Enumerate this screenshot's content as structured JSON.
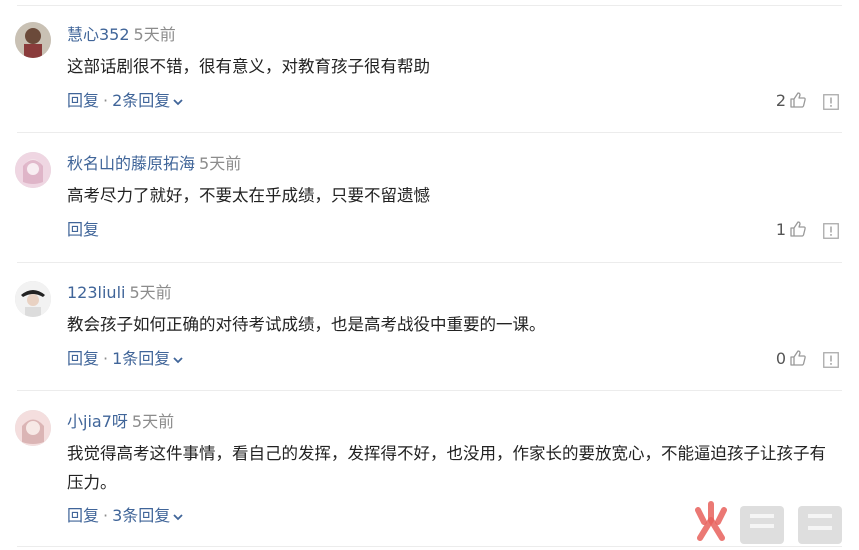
{
  "comments": [
    {
      "username": "慧心352",
      "time": "5天前",
      "text": "这部话剧很不错，很有意义，对教育孩子很有帮助",
      "reply_label": "回复",
      "separator": "·",
      "replies_label": "2条回复",
      "likes": "2"
    },
    {
      "username": "秋名山的藤原拓海",
      "time": "5天前",
      "text": "高考尽力了就好，不要太在乎成绩，只要不留遗憾",
      "reply_label": "回复",
      "likes": "1"
    },
    {
      "username": "123liuli",
      "time": "5天前",
      "text": "教会孩子如何正确的对待考试成绩，也是高考战役中重要的一课。",
      "reply_label": "回复",
      "separator": "·",
      "replies_label": "1条回复",
      "likes": "0"
    },
    {
      "username": "小jia7呀",
      "time": "5天前",
      "text": "我觉得高考这件事情，看自己的发挥，发挥得不好，也没用，作家长的要放宽心，不能逼迫孩子让孩子有压力。",
      "reply_label": "回复",
      "separator": "·",
      "replies_label": "3条回复"
    }
  ],
  "icons": {
    "like": "thumbs-up-icon",
    "report": "report-icon",
    "expand": "chevron-down-icon"
  },
  "colors": {
    "link": "#406599",
    "muted": "#8c8c8c",
    "text": "#222222",
    "divider": "#ececec"
  }
}
